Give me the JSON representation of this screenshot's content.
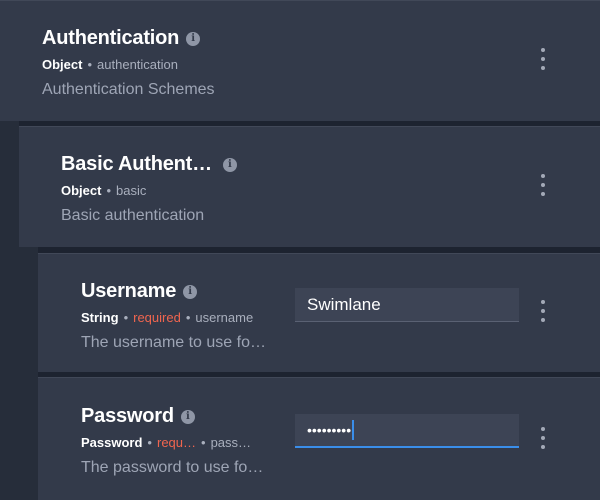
{
  "auth": {
    "title": "Authentication",
    "type": "Object",
    "key": "authentication",
    "description": "Authentication Schemes"
  },
  "basic": {
    "title": "Basic Authent…",
    "type": "Object",
    "key": "basic",
    "description": "Basic authentication"
  },
  "username": {
    "title": "Username",
    "type": "String",
    "required": "required",
    "key": "username",
    "description": "The username to use fo…",
    "value": "Swimlane"
  },
  "password": {
    "title": "Password",
    "type": "Password",
    "required": "requ…",
    "key": "pass…",
    "description": "The password to use fo…",
    "value": "•••••••••"
  },
  "icons": {
    "info": "info-icon",
    "menu": "more-vertical-icon"
  },
  "colors": {
    "card": "#333a4a",
    "background": "#1f2633",
    "required": "#f0654f",
    "focus": "#3a8eea"
  }
}
